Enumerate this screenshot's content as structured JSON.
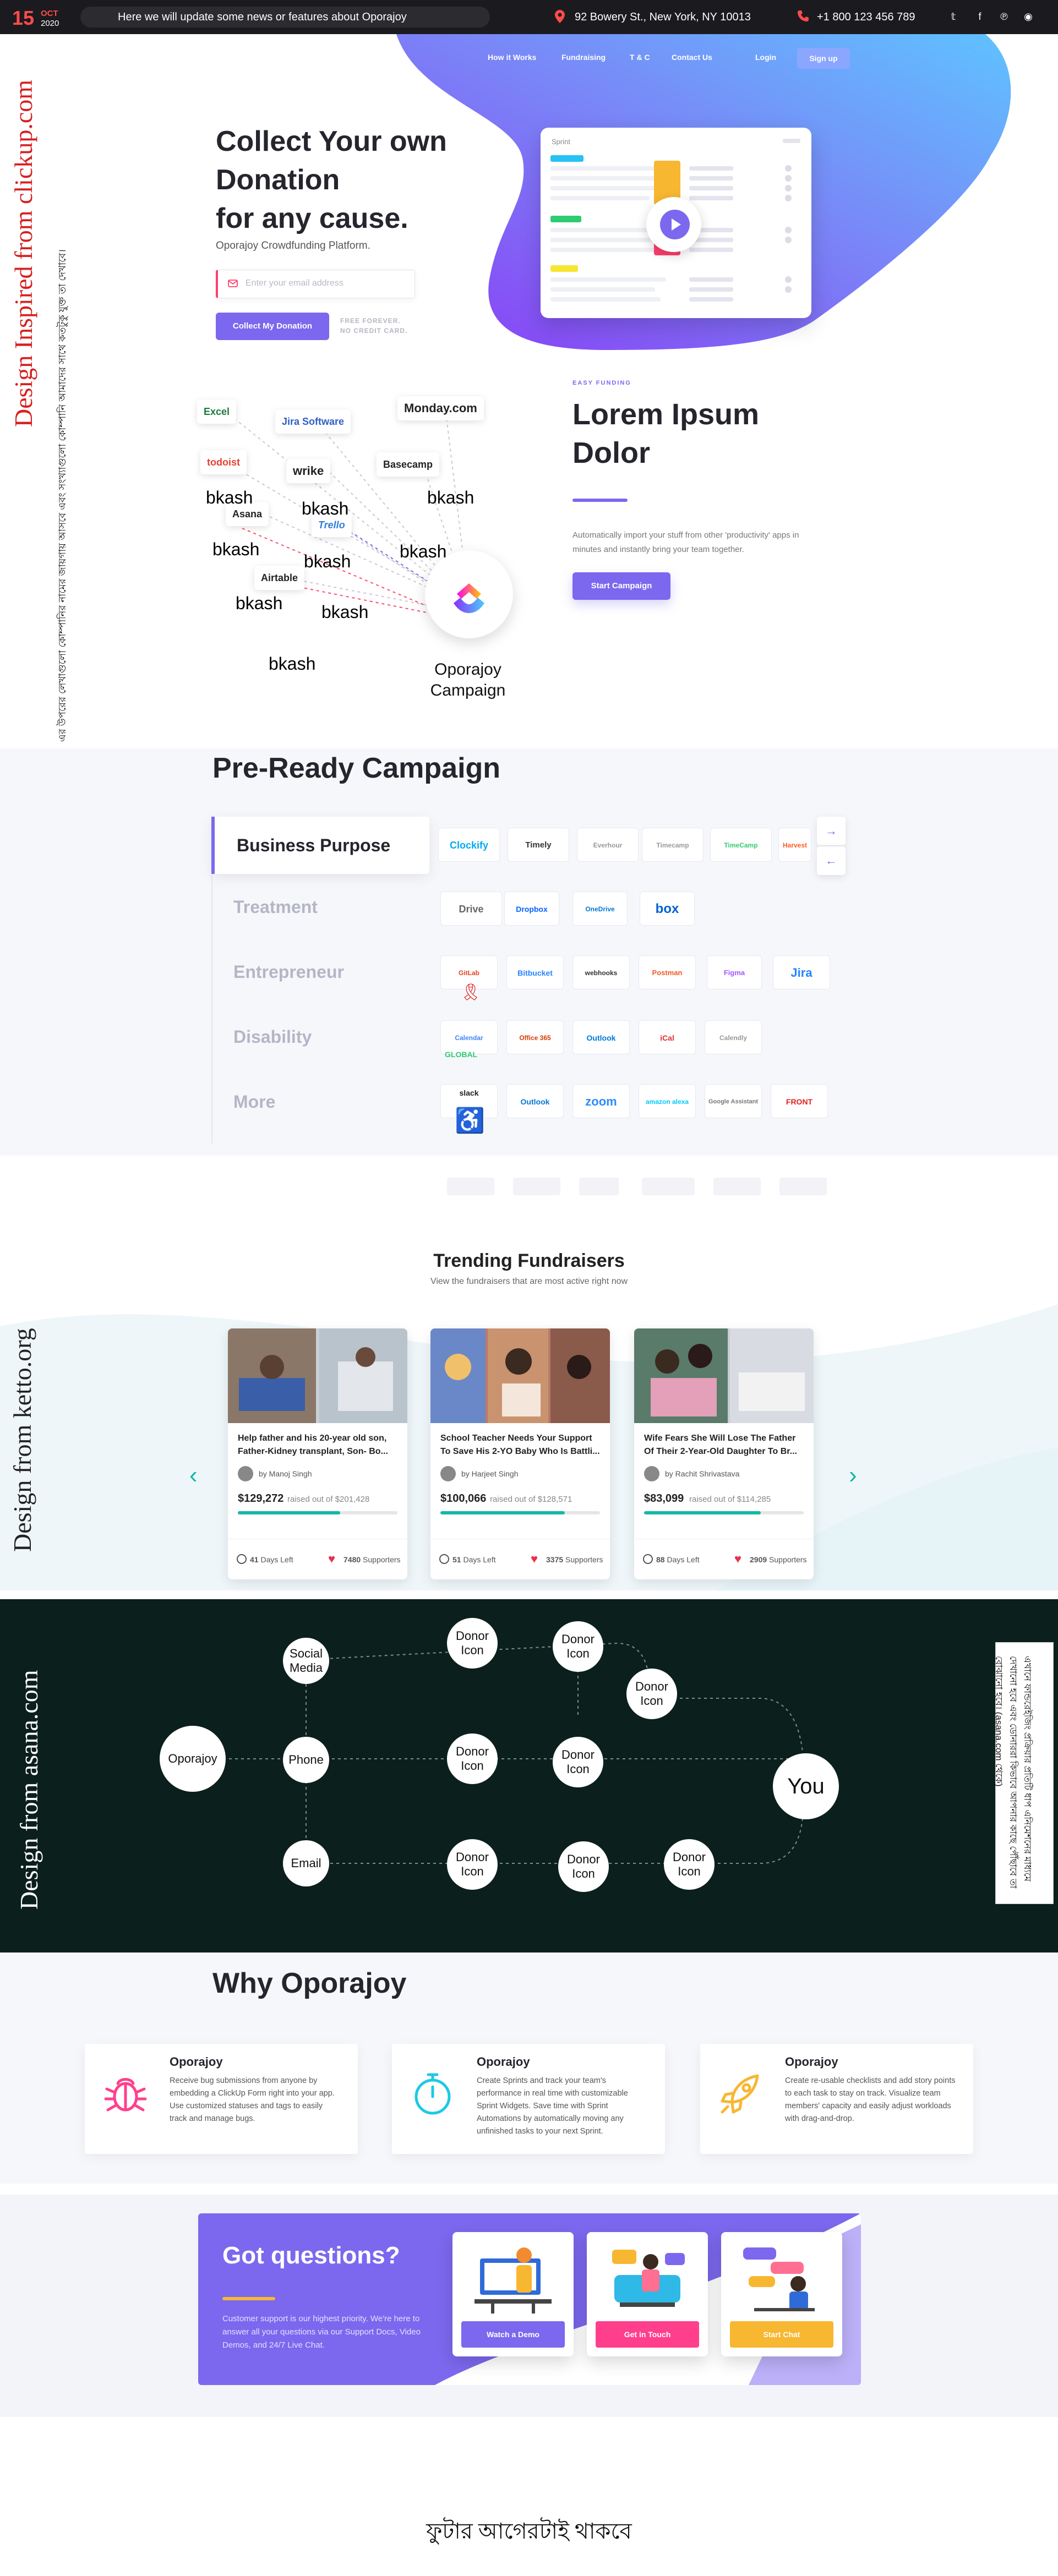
{
  "topbar": {
    "day": "15",
    "month": "OCT",
    "year": "2020",
    "news": "Here we will update some news or features about Oporajoy",
    "address": "92 Bowery St., New York, NY 10013",
    "phone": "+1 800 123 456 789",
    "social_icons": [
      "twitter-icon",
      "facebook-icon",
      "pinterest-icon",
      "instagram-icon"
    ]
  },
  "nav": {
    "items": [
      "How it Works",
      "Fundraising",
      "T & C",
      "Contact Us",
      "Login"
    ],
    "signup": "Sign up"
  },
  "hero": {
    "title_lines": [
      "Collect Your own",
      "Donation",
      "for any cause."
    ],
    "subtitle": "Oporajoy Crowdfunding Platform.",
    "email_placeholder": "Enter your email address",
    "cta": "Collect My Donation",
    "free_note_1": "FREE FOREVER.",
    "free_note_2": "NO CREDIT CARD.",
    "mock_title": "Sprint",
    "mock_tag": "Pale Inc."
  },
  "side_labels": {
    "clickup": "Design Inspired from clickup.com",
    "ketto": "Design from ketto.org",
    "asana": "Design from asana.com"
  },
  "notes": {
    "bn_left": "এর উপরের লেখাগুলো কোম্পানির নামের জায়গায় আসবে এবং সংখ্যাগুলো কোম্পানি আমাদের সাথে কতটুকু যুক্ত তা দেখাবে।",
    "bn_right": "এখানে ফান্ডরেইজিং প্রক্রিয়ার প্রতিটি ধাপ এনিমেশনের মাধ্যমে দেখানো হবে এবং ডোনাররা কিভাবে আপনার কাছে পৌঁছাবে তা বোঝানো হবে। (asana.com থেকে)",
    "footer": "ফুটার আগেরটাই থাকবে"
  },
  "integrations": {
    "logos": [
      "Excel",
      "Jira Software",
      "Monday.com",
      "todoist",
      "wrike",
      "Basecamp",
      "Asana",
      "Trello",
      "Airtable"
    ],
    "bkash": "bkash",
    "center_label_1": "Oporajoy",
    "center_label_2": "Campaign",
    "eyebrow": "EASY FUNDING",
    "title_lines": [
      "Lorem Ipsum",
      "Dolor"
    ],
    "desc": "Automatically import your stuff from other 'productivity' apps in minutes and instantly bring your team together.",
    "cta": "Start Campaign"
  },
  "pre_ready": {
    "title": "Pre-Ready Campaign",
    "categories": [
      "Business Purpose",
      "Treatment",
      "Entrepreneur",
      "Disability",
      "More"
    ],
    "rows": [
      [
        "Clockify",
        "Timely",
        "Everhour",
        "Timecamp",
        "TimeCamp",
        "Harvest"
      ],
      [
        "Drive",
        "Dropbox",
        "OneDrive",
        "box"
      ],
      [
        "GitLab",
        "Bitbucket",
        "webhooks",
        "Postman",
        "Figma",
        "Jira"
      ],
      [
        "Calendar",
        "Office 365",
        "Outlook",
        "iCal",
        "Calendly"
      ],
      [
        "slack",
        "Outlook",
        "zoom",
        "amazon alexa",
        "Google Assistant",
        "FRONT"
      ]
    ],
    "global_label": "GLOBAL"
  },
  "trending": {
    "title": "Trending Fundraisers",
    "subtitle": "View the fundraisers that are most active right now",
    "cards": [
      {
        "title": "Help father and his 20-year old son, Father-Kidney transplant, Son- Bo...",
        "by": "by Manoj Singh",
        "raised": "$129,272",
        "goal": "raised out of $201,428",
        "progress": 0.64,
        "days": "41",
        "days_label": "Days Left",
        "supporters": "7480",
        "supporters_label": "Supporters"
      },
      {
        "title": "School Teacher Needs Your Support To Save His 2-YO Baby Who Is Battli...",
        "by": "by Harjeet Singh",
        "raised": "$100,066",
        "goal": "raised out of $128,571",
        "progress": 0.78,
        "days": "51",
        "days_label": "Days Left",
        "supporters": "3375",
        "supporters_label": "Supporters"
      },
      {
        "title": "Wife Fears She Will Lose The Father Of Their 2-Year-Old Daughter To Br...",
        "by": "by Rachit Shrivastava",
        "raised": "$83,099",
        "goal": "raised out of $114,285",
        "progress": 0.73,
        "days": "88",
        "days_label": "Days Left",
        "supporters": "2909",
        "supporters_label": "Supporters"
      }
    ]
  },
  "flow": {
    "origin": "Oporajoy",
    "social": "Social Media",
    "phone": "Phone",
    "email": "Email",
    "donor": "Donor Icon",
    "you": "You"
  },
  "why": {
    "title": "Why Oporajoy",
    "items": [
      {
        "title": "Oporajoy",
        "desc": "Receive bug submissions from anyone by embedding a ClickUp Form right into your app. Use customized statuses and tags to easily track and manage bugs.",
        "icon": "bug-icon"
      },
      {
        "title": "Oporajoy",
        "desc": "Create Sprints and track your team's performance in real time with customizable Sprint Widgets. Save time with Sprint Automations by automatically moving any unfinished tasks to your next Sprint.",
        "icon": "stopwatch-icon"
      },
      {
        "title": "Oporajoy",
        "desc": "Create re-usable checklists and add story points to each task to stay on track. Visualize team members' capacity and easily adjust workloads with drag-and-drop.",
        "icon": "rocket-icon"
      }
    ]
  },
  "questions": {
    "title": "Got questions?",
    "desc": "Customer support is our highest priority. We're here to answer all your questions via our Support Docs, Video Demos, and 24/7 Live Chat.",
    "buttons": [
      "Watch a Demo",
      "Get in Touch",
      "Start Chat"
    ]
  },
  "colors": {
    "brand": "#7b68ee",
    "accent_pink": "#ff3f6c",
    "teal": "#14b8a6",
    "dark": "#0b1f1c"
  }
}
